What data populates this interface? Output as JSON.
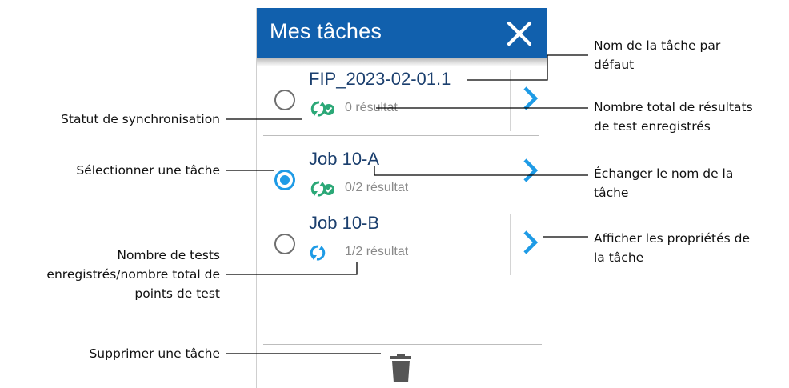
{
  "panel": {
    "title": "Mes tâches",
    "close_icon": "close-icon",
    "colors": {
      "header": "#1160ad",
      "accent": "#1e9be6",
      "job_name": "#1b3f6e",
      "sync_done": "#2ba877"
    },
    "jobs": [
      {
        "name": "FIP_2023-02-01.1",
        "results": "0 résultat",
        "selected": false,
        "sync_state": "synced",
        "icon": "sync-check-icon"
      },
      {
        "name": "Job 10-A",
        "results": "0/2 résultat",
        "selected": true,
        "sync_state": "synced",
        "icon": "sync-check-icon"
      },
      {
        "name": "Job 10-B",
        "results": "1/2 résultat",
        "selected": false,
        "sync_state": "pending",
        "icon": "sync-pending-icon"
      }
    ],
    "delete_icon": "trash-icon"
  },
  "annotations": {
    "sync_status": "Statut de synchronisation",
    "select_job": "Sélectionner une tâche",
    "tests_count": [
      "Nombre de tests",
      "enregistrés/nombre total de",
      "points de test"
    ],
    "delete_job": "Supprimer une tâche",
    "default_name": [
      "Nom de la tâche par",
      "défaut"
    ],
    "total_results": [
      "Nombre total de résultats",
      "de test enregistrés"
    ],
    "exchange_name": [
      "Échanger le nom de la",
      "tâche"
    ],
    "show_properties": [
      "Afficher les propriétés de",
      "la tâche"
    ]
  }
}
